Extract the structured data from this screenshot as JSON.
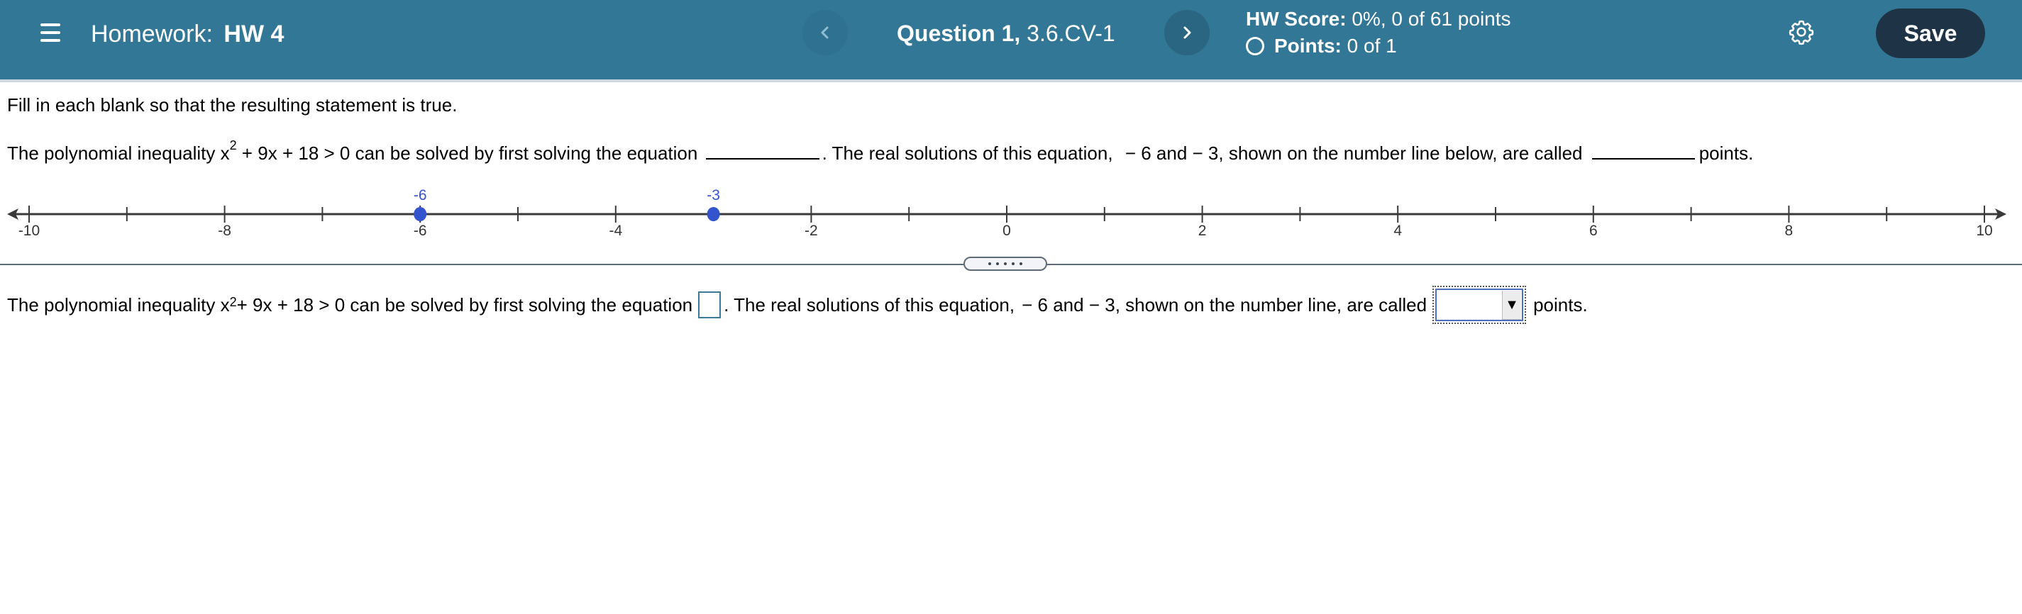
{
  "header": {
    "menu_icon": "hamburger-menu-icon",
    "title_prefix": "Homework:",
    "title_name": "HW 4",
    "prev_icon": "chevron-left-icon",
    "next_icon": "chevron-right-icon",
    "question_label": "Question 1,",
    "question_id": "3.6.CV-1",
    "hw_score_label": "HW Score:",
    "hw_score_value": "0%, 0 of 61 points",
    "points_status_icon": "empty-circle-icon",
    "points_label": "Points:",
    "points_value": "0 of 1",
    "settings_icon": "gear-icon",
    "save_label": "Save",
    "colors": {
      "header_bg": "#327795",
      "save_bg": "#1e3446"
    }
  },
  "question": {
    "instruction": "Fill in each blank so that the resulting statement is true.",
    "statement": {
      "part1": "The polynomial inequality x",
      "exponent": "2",
      "part2": " + 9x + 18 > 0 can be solved by first solving the equation",
      "part3": ". The real solutions of this equation,",
      "sol1": "− 6",
      "and": " and ",
      "sol2": "− 3",
      "part4_preview": ", shown on the number line below, are called",
      "part4_answer": ", shown on the number line, are called",
      "part5": "points."
    },
    "number_line": {
      "min": -10,
      "max": 10,
      "labeled_ticks": [
        "-10",
        "-8",
        "-6",
        "-4",
        "-2",
        "0",
        "2",
        "4",
        "6",
        "8",
        "10"
      ],
      "points": [
        {
          "value": -6,
          "label": "-6"
        },
        {
          "value": -3,
          "label": "-3"
        }
      ],
      "point_color": "#3354cc"
    },
    "answer": {
      "equation_input_value": "",
      "dropdown_selected": "",
      "dropdown_arrow_icon": "triangle-down-icon"
    }
  }
}
